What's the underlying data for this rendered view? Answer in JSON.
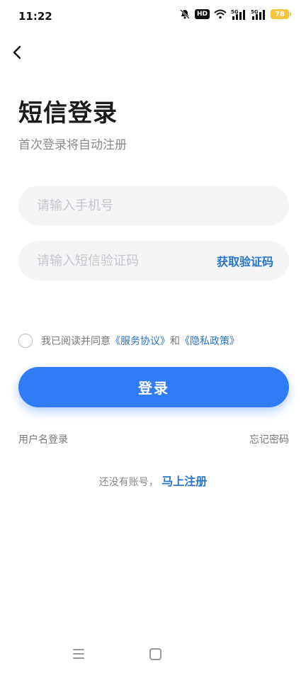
{
  "statusbar": {
    "time": "11:22",
    "hd": "HD",
    "battery": "78",
    "icons": [
      "bell-muted-icon",
      "wifi-icon",
      "signal-5g-icon",
      "signal-5g-icon-2"
    ]
  },
  "header": {
    "title": "短信登录",
    "subtitle": "首次登录将自动注册"
  },
  "form": {
    "phone_placeholder": "请输入手机号",
    "code_placeholder": "请输入短信验证码",
    "get_code": "获取验证码"
  },
  "agreement": {
    "prefix": "我已阅读并同意",
    "service": "《服务协议》",
    "and": "和",
    "privacy": "《隐私政策》"
  },
  "buttons": {
    "login": "登录"
  },
  "links": {
    "username_login": "用户名登录",
    "forgot_password": "忘记密码",
    "no_account": "还没有账号，",
    "register": "马上注册"
  },
  "colors": {
    "accent": "#2f7cf6",
    "link": "#2a74c9",
    "battery": "#f6c33a"
  }
}
